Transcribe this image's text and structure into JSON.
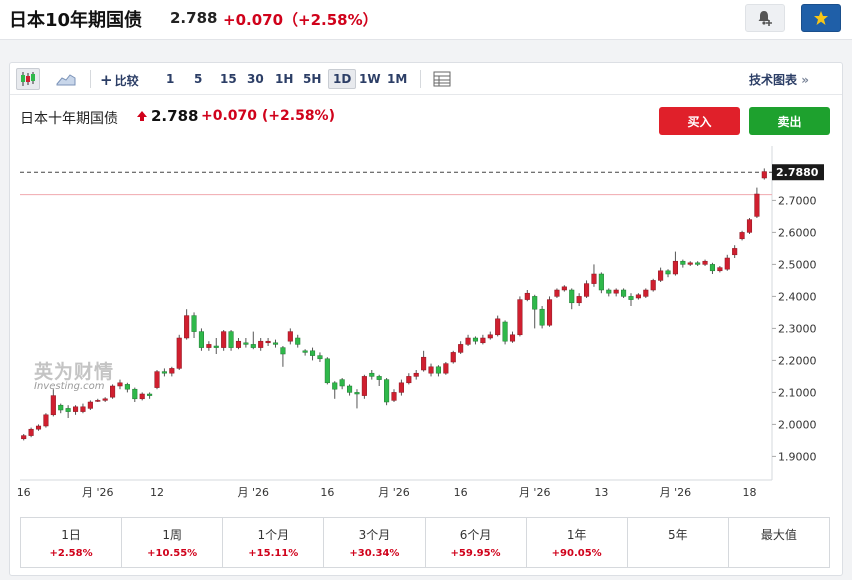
{
  "header": {
    "title": "日本10年期国债",
    "price": "2.788",
    "change": "+0.070（+2.58%）",
    "icons": {
      "alert": "bell-plus-icon",
      "watchlist": "star-icon"
    }
  },
  "toolbar": {
    "compare_label": "比较",
    "periods": [
      "1",
      "5",
      "15",
      "30",
      "1H",
      "5H",
      "1D",
      "1W",
      "1M"
    ],
    "active_period": "1D",
    "tech_chart_label": "技术图表",
    "tech_chart_arrow": "»",
    "icons": {
      "candles": "candlestick-icon",
      "area": "area-chart-icon",
      "table": "table-icon"
    }
  },
  "instrument": {
    "name": "日本十年期国债",
    "price": "2.788",
    "change": "+0.070",
    "change_pct": "(+2.58%)",
    "buy_label": "买入",
    "sell_label": "卖出"
  },
  "watermark": {
    "cn": "英为财情",
    "en": "Investing.com"
  },
  "chart_data": {
    "type": "candlestick",
    "last_price": 2.788,
    "last_price_label": "2.7880",
    "ylim": [
      1.87,
      2.87
    ],
    "yticks": [
      1.9,
      2.0,
      2.1,
      2.2,
      2.3,
      2.4,
      2.5,
      2.6,
      2.7
    ],
    "ytick_labels": [
      "1.9000",
      "2.0000",
      "2.1000",
      "2.2000",
      "2.3000",
      "2.4000",
      "2.5000",
      "2.6000",
      "2.7000"
    ],
    "reference_line": 2.718,
    "xtick_labels": [
      {
        "label": "16",
        "index": 0
      },
      {
        "label": "月 '26",
        "index": 10
      },
      {
        "label": "12",
        "index": 18
      },
      {
        "label": "月 '26",
        "index": 31
      },
      {
        "label": "16",
        "index": 41
      },
      {
        "label": "月 '26",
        "index": 50
      },
      {
        "label": "16",
        "index": 59
      },
      {
        "label": "月 '26",
        "index": 69
      },
      {
        "label": "13",
        "index": 78
      },
      {
        "label": "月 '26",
        "index": 88
      },
      {
        "label": "18",
        "index": 98
      }
    ],
    "colors": {
      "up": "#d01f2f",
      "down": "#2fb84a",
      "wick": "#555555",
      "last": "#d01f2f"
    },
    "candles": [
      [
        1.955,
        1.965,
        1.95,
        1.97
      ],
      [
        1.965,
        1.985,
        1.96,
        1.99
      ],
      [
        1.985,
        1.995,
        1.98,
        2.0
      ],
      [
        1.995,
        2.03,
        1.99,
        2.035
      ],
      [
        2.03,
        2.09,
        2.025,
        2.11
      ],
      [
        2.06,
        2.045,
        2.035,
        2.065
      ],
      [
        2.05,
        2.04,
        2.02,
        2.06
      ],
      [
        2.04,
        2.055,
        2.03,
        2.06
      ],
      [
        2.04,
        2.055,
        2.035,
        2.065
      ],
      [
        2.05,
        2.07,
        2.045,
        2.075
      ],
      [
        2.075,
        2.075,
        2.07,
        2.08
      ],
      [
        2.075,
        2.08,
        2.07,
        2.085
      ],
      [
        2.085,
        2.12,
        2.08,
        2.125
      ],
      [
        2.12,
        2.13,
        2.11,
        2.14
      ],
      [
        2.125,
        2.11,
        2.1,
        2.13
      ],
      [
        2.11,
        2.08,
        2.07,
        2.115
      ],
      [
        2.08,
        2.095,
        2.075,
        2.1
      ],
      [
        2.095,
        2.09,
        2.08,
        2.1
      ],
      [
        2.115,
        2.165,
        2.11,
        2.17
      ],
      [
        2.165,
        2.16,
        2.15,
        2.175
      ],
      [
        2.16,
        2.175,
        2.15,
        2.18
      ],
      [
        2.175,
        2.27,
        2.17,
        2.28
      ],
      [
        2.27,
        2.34,
        2.265,
        2.36
      ],
      [
        2.34,
        2.29,
        2.27,
        2.35
      ],
      [
        2.29,
        2.24,
        2.23,
        2.3
      ],
      [
        2.24,
        2.25,
        2.23,
        2.26
      ],
      [
        2.245,
        2.24,
        2.22,
        2.27
      ],
      [
        2.24,
        2.29,
        2.23,
        2.295
      ],
      [
        2.29,
        2.24,
        2.23,
        2.295
      ],
      [
        2.24,
        2.26,
        2.235,
        2.27
      ],
      [
        2.255,
        2.25,
        2.24,
        2.27
      ],
      [
        2.25,
        2.24,
        2.235,
        2.29
      ],
      [
        2.24,
        2.26,
        2.23,
        2.27
      ],
      [
        2.255,
        2.26,
        2.245,
        2.27
      ],
      [
        2.255,
        2.25,
        2.24,
        2.265
      ],
      [
        2.24,
        2.22,
        2.18,
        2.245
      ],
      [
        2.26,
        2.29,
        2.25,
        2.3
      ],
      [
        2.27,
        2.25,
        2.24,
        2.28
      ],
      [
        2.23,
        2.225,
        2.215,
        2.235
      ],
      [
        2.23,
        2.215,
        2.2,
        2.24
      ],
      [
        2.215,
        2.205,
        2.195,
        2.225
      ],
      [
        2.205,
        2.13,
        2.125,
        2.21
      ],
      [
        2.13,
        2.11,
        2.08,
        2.135
      ],
      [
        2.14,
        2.12,
        2.11,
        2.145
      ],
      [
        2.12,
        2.1,
        2.09,
        2.125
      ],
      [
        2.1,
        2.095,
        2.05,
        2.11
      ],
      [
        2.09,
        2.15,
        2.08,
        2.155
      ],
      [
        2.16,
        2.15,
        2.14,
        2.17
      ],
      [
        2.15,
        2.14,
        2.12,
        2.155
      ],
      [
        2.14,
        2.07,
        2.06,
        2.145
      ],
      [
        2.075,
        2.1,
        2.07,
        2.11
      ],
      [
        2.1,
        2.13,
        2.09,
        2.14
      ],
      [
        2.13,
        2.15,
        2.125,
        2.16
      ],
      [
        2.15,
        2.16,
        2.14,
        2.17
      ],
      [
        2.17,
        2.21,
        2.165,
        2.23
      ],
      [
        2.16,
        2.18,
        2.15,
        2.19
      ],
      [
        2.18,
        2.16,
        2.15,
        2.185
      ],
      [
        2.16,
        2.19,
        2.155,
        2.195
      ],
      [
        2.195,
        2.225,
        2.19,
        2.23
      ],
      [
        2.225,
        2.25,
        2.22,
        2.26
      ],
      [
        2.25,
        2.27,
        2.245,
        2.28
      ],
      [
        2.27,
        2.26,
        2.25,
        2.275
      ],
      [
        2.255,
        2.27,
        2.25,
        2.28
      ],
      [
        2.27,
        2.28,
        2.265,
        2.29
      ],
      [
        2.28,
        2.33,
        2.275,
        2.34
      ],
      [
        2.32,
        2.26,
        2.25,
        2.325
      ],
      [
        2.26,
        2.28,
        2.255,
        2.29
      ],
      [
        2.28,
        2.39,
        2.275,
        2.4
      ],
      [
        2.39,
        2.41,
        2.385,
        2.42
      ],
      [
        2.4,
        2.36,
        2.3,
        2.405
      ],
      [
        2.36,
        2.31,
        2.3,
        2.37
      ],
      [
        2.31,
        2.39,
        2.305,
        2.4
      ],
      [
        2.4,
        2.42,
        2.395,
        2.425
      ],
      [
        2.42,
        2.43,
        2.415,
        2.435
      ],
      [
        2.42,
        2.38,
        2.36,
        2.425
      ],
      [
        2.38,
        2.4,
        2.37,
        2.41
      ],
      [
        2.4,
        2.44,
        2.395,
        2.45
      ],
      [
        2.44,
        2.47,
        2.43,
        2.5
      ],
      [
        2.47,
        2.42,
        2.41,
        2.475
      ],
      [
        2.42,
        2.41,
        2.4,
        2.425
      ],
      [
        2.41,
        2.42,
        2.4,
        2.425
      ],
      [
        2.42,
        2.4,
        2.395,
        2.425
      ],
      [
        2.4,
        2.39,
        2.37,
        2.41
      ],
      [
        2.395,
        2.405,
        2.39,
        2.41
      ],
      [
        2.4,
        2.42,
        2.395,
        2.425
      ],
      [
        2.42,
        2.45,
        2.415,
        2.455
      ],
      [
        2.45,
        2.48,
        2.445,
        2.49
      ],
      [
        2.48,
        2.47,
        2.46,
        2.485
      ],
      [
        2.47,
        2.51,
        2.465,
        2.54
      ],
      [
        2.51,
        2.5,
        2.49,
        2.515
      ],
      [
        2.5,
        2.505,
        2.495,
        2.51
      ],
      [
        2.505,
        2.5,
        2.495,
        2.51
      ],
      [
        2.5,
        2.51,
        2.495,
        2.515
      ],
      [
        2.5,
        2.48,
        2.47,
        2.505
      ],
      [
        2.48,
        2.49,
        2.475,
        2.495
      ],
      [
        2.485,
        2.52,
        2.48,
        2.53
      ],
      [
        2.53,
        2.55,
        2.52,
        2.56
      ],
      [
        2.58,
        2.6,
        2.575,
        2.605
      ],
      [
        2.6,
        2.64,
        2.595,
        2.645
      ],
      [
        2.65,
        2.72,
        2.645,
        2.74
      ],
      [
        2.77,
        2.79,
        2.765,
        2.8
      ]
    ]
  },
  "performance": [
    {
      "label": "1日",
      "value": "+2.58%"
    },
    {
      "label": "1周",
      "value": "+10.55%"
    },
    {
      "label": "1个月",
      "value": "+15.11%"
    },
    {
      "label": "3个月",
      "value": "+30.34%"
    },
    {
      "label": "6个月",
      "value": "+59.95%"
    },
    {
      "label": "1年",
      "value": "+90.05%"
    },
    {
      "label": "5年",
      "value": ""
    },
    {
      "label": "最大值",
      "value": ""
    }
  ]
}
